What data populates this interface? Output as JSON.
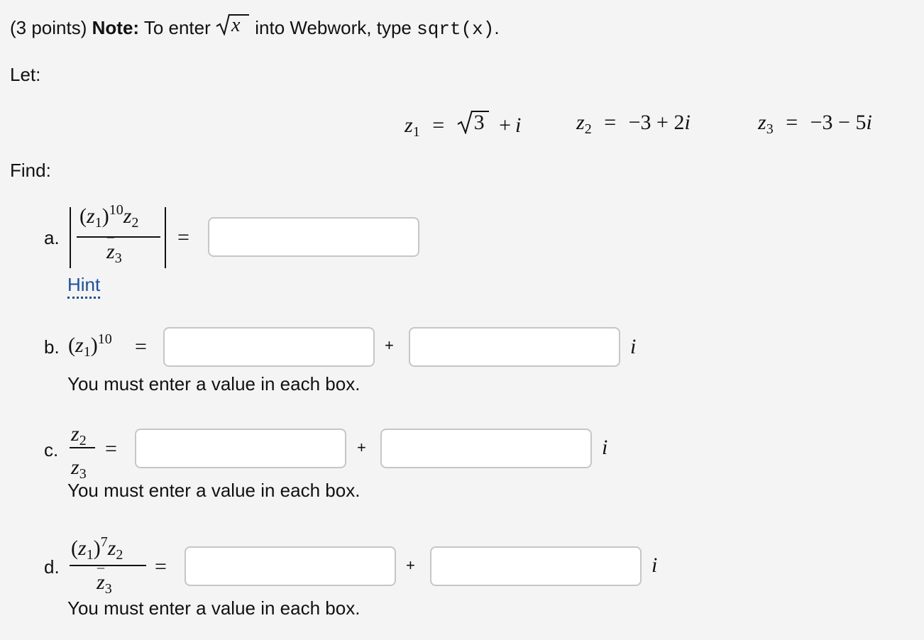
{
  "header": {
    "points": "(3 points)",
    "note_label": "Note:",
    "note_text": "To enter",
    "note_sqrt_var": "x",
    "note_text2": "into Webwork, type",
    "note_code": "sqrt(x)",
    "note_end": "."
  },
  "let_label": "Let:",
  "definitions": {
    "z1": {
      "lhs": "z",
      "sub": "1",
      "eq": "=",
      "rad": "3",
      "rest": "+",
      "i": "i"
    },
    "z2": {
      "lhs": "z",
      "sub": "2",
      "eq": "=",
      "rhs": "−3 + 2",
      "i": "i"
    },
    "z3": {
      "lhs": "z",
      "sub": "3",
      "eq": "=",
      "rhs": "−3 − 5",
      "i": "i"
    }
  },
  "find_label": "Find:",
  "parts": {
    "a": {
      "label": "a.",
      "power": "10",
      "hint": "Hint",
      "eq": "="
    },
    "b": {
      "label": "b.",
      "power": "10",
      "eq": "=",
      "plus": "+",
      "i": "i",
      "note": "You must enter a value in each box."
    },
    "c": {
      "label": "c.",
      "eq": "=",
      "plus": "+",
      "i": "i",
      "note": "You must enter a value in each box."
    },
    "d": {
      "label": "d.",
      "power": "7",
      "eq": "=",
      "plus": "+",
      "i": "i",
      "note": "You must enter a value in each box."
    }
  },
  "inputs": {
    "a": "",
    "b_real": "",
    "b_imag": "",
    "c_real": "",
    "c_imag": "",
    "d_real": "",
    "d_imag": ""
  }
}
